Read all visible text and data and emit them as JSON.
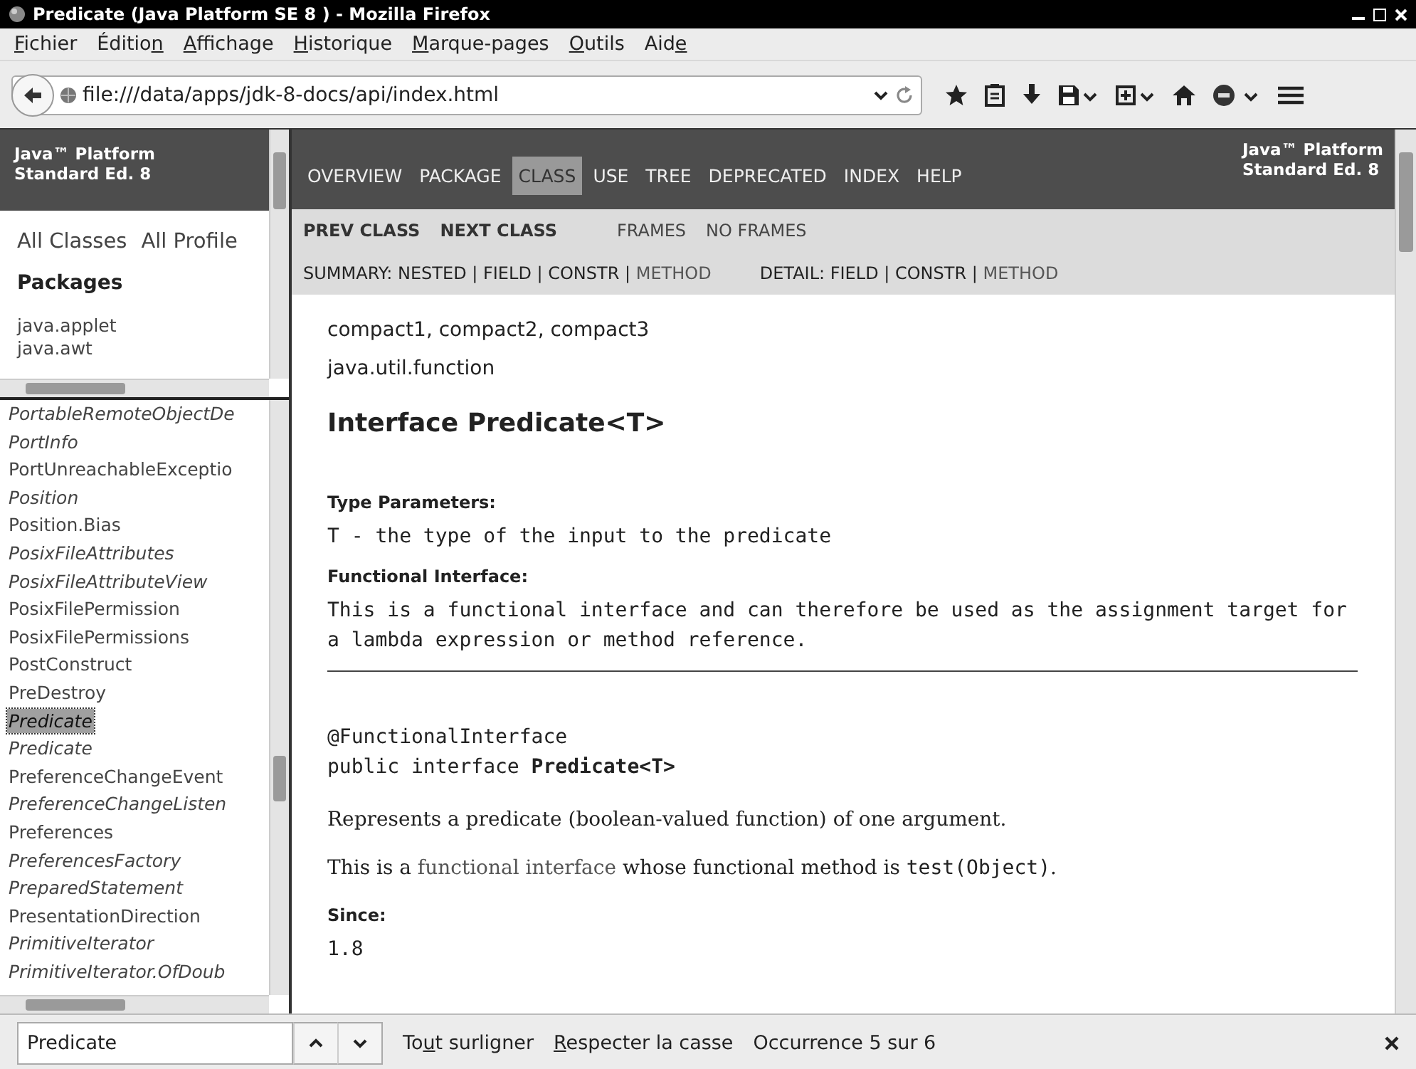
{
  "window": {
    "title": "Predicate (Java Platform SE 8 ) - Mozilla Firefox"
  },
  "menu": [
    {
      "key": "F",
      "after": "ichier"
    },
    {
      "before": "Éditio",
      "key": "n"
    },
    {
      "key": "A",
      "after": "ffichage"
    },
    {
      "key": "H",
      "after": "istorique"
    },
    {
      "key": "M",
      "after": "arque-pages"
    },
    {
      "key": "O",
      "after": "utils"
    },
    {
      "before": "Aid",
      "key": "e"
    }
  ],
  "address_bar": {
    "url": "file:///data/apps/jdk-8-docs/api/index.html"
  },
  "left_top": {
    "header": "Java™ Platform\nStandard Ed. 8",
    "links": [
      "All Classes",
      "All Profile"
    ],
    "heading": "Packages",
    "packages": [
      "java.applet",
      "java.awt"
    ]
  },
  "class_list": [
    {
      "name": "PortableRemoteObjectDe",
      "kind": "interface",
      "selected": false
    },
    {
      "name": "PortInfo",
      "kind": "interface",
      "selected": false
    },
    {
      "name": "PortUnreachableExceptio",
      "kind": "class",
      "selected": false
    },
    {
      "name": "Position",
      "kind": "interface",
      "selected": false
    },
    {
      "name": "Position.Bias",
      "kind": "class",
      "selected": false
    },
    {
      "name": "PosixFileAttributes",
      "kind": "interface",
      "selected": false
    },
    {
      "name": "PosixFileAttributeView",
      "kind": "interface",
      "selected": false
    },
    {
      "name": "PosixFilePermission",
      "kind": "class",
      "selected": false
    },
    {
      "name": "PosixFilePermissions",
      "kind": "class",
      "selected": false
    },
    {
      "name": "PostConstruct",
      "kind": "class",
      "selected": false
    },
    {
      "name": "PreDestroy",
      "kind": "class",
      "selected": false
    },
    {
      "name": "Predicate",
      "kind": "interface",
      "selected": true
    },
    {
      "name": "Predicate",
      "kind": "interface",
      "selected": false
    },
    {
      "name": "PreferenceChangeEvent",
      "kind": "class",
      "selected": false
    },
    {
      "name": "PreferenceChangeListen",
      "kind": "interface",
      "selected": false
    },
    {
      "name": "Preferences",
      "kind": "class",
      "selected": false
    },
    {
      "name": "PreferencesFactory",
      "kind": "interface",
      "selected": false
    },
    {
      "name": "PreparedStatement",
      "kind": "interface",
      "selected": false
    },
    {
      "name": "PresentationDirection",
      "kind": "class",
      "selected": false
    },
    {
      "name": "PrimitiveIterator",
      "kind": "interface",
      "selected": false
    },
    {
      "name": "PrimitiveIterator.OfDoub",
      "kind": "interface",
      "selected": false
    }
  ],
  "top_nav": {
    "items": [
      {
        "label": "OVERVIEW",
        "selected": false
      },
      {
        "label": "PACKAGE",
        "selected": false
      },
      {
        "label": "CLASS",
        "selected": true
      },
      {
        "label": "USE",
        "selected": false
      },
      {
        "label": "TREE",
        "selected": false
      },
      {
        "label": "DEPRECATED",
        "selected": false
      },
      {
        "label": "INDEX",
        "selected": false
      },
      {
        "label": "HELP",
        "selected": false
      }
    ],
    "about": "Java™ Platform\nStandard Ed. 8"
  },
  "sub_nav": {
    "links": [
      {
        "text": "PREV CLASS",
        "kind": "strong"
      },
      {
        "text": "NEXT CLASS",
        "kind": "strong"
      },
      {
        "text": "FRAMES",
        "kind": "plain"
      },
      {
        "text": "NO FRAMES",
        "kind": "plain"
      }
    ],
    "summary": [
      {
        "text": "SUMMARY: NESTED | FIELD | CONSTR | ",
        "kind": "text"
      },
      {
        "text": "METHOD",
        "kind": "link"
      }
    ],
    "detail": [
      {
        "text": "DETAIL: FIELD | CONSTR | ",
        "kind": "text"
      },
      {
        "text": "METHOD",
        "kind": "link"
      }
    ]
  },
  "content": {
    "profiles": "compact1, compact2, compact3",
    "package": "java.util.function",
    "title": "Interface Predicate<T>",
    "type_parameters": {
      "label": "Type Parameters:",
      "text": "T - the type of the input to the predicate"
    },
    "functional_interface": {
      "label": "Functional Interface:",
      "text": "This is a functional interface and can therefore be used as the assignment target for a lambda expression or method reference."
    },
    "annotation": "@FunctionalInterface",
    "declaration": "public interface **Predicate<T>**",
    "description": "Represents a predicate (boolean-valued function) of one argument.",
    "note": [
      {
        "text": "This is a ",
        "kind": "text"
      },
      {
        "text": "functional interface",
        "kind": "link"
      },
      {
        "text": " whose functional method is ",
        "kind": "text"
      },
      {
        "text": "test(Object)",
        "kind": "code"
      },
      {
        "text": ".",
        "kind": "text"
      }
    ],
    "since": {
      "label": "Since:",
      "text": "1.8"
    }
  },
  "find_bar": {
    "query": "Predicate",
    "options": [
      {
        "before": "To",
        "key": "u",
        "after": "t surligner"
      },
      {
        "key": "R",
        "after": "especter la casse"
      }
    ],
    "status": "Occurrence 5 sur 6"
  }
}
